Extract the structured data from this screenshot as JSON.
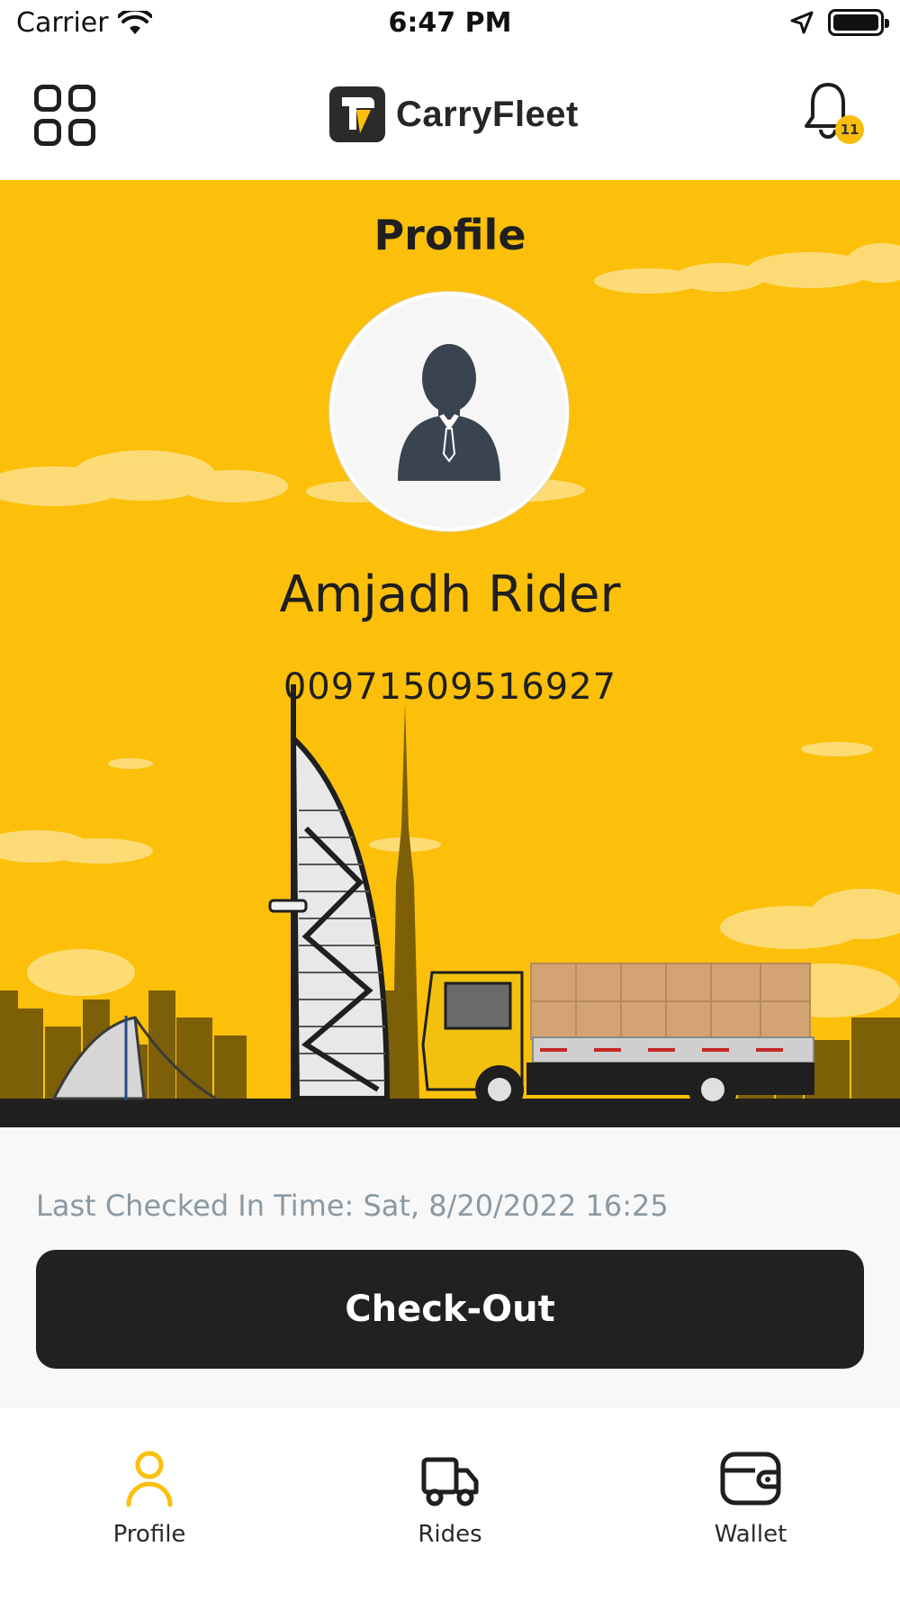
{
  "status_bar": {
    "carrier": "Carrier",
    "time": "6:47 PM"
  },
  "header": {
    "app_name": "CarryFleet",
    "notification_count": "11"
  },
  "profile": {
    "title": "Profile",
    "name": "Amjadh Rider",
    "phone": "00971509516927"
  },
  "check": {
    "last_checked_label": "Last Checked In Time: Sat, 8/20/2022 16:25",
    "button_label": "Check-Out"
  },
  "tabs": [
    {
      "label": "Profile",
      "icon": "person-icon",
      "active": true
    },
    {
      "label": "Rides",
      "icon": "truck-icon",
      "active": false
    },
    {
      "label": "Wallet",
      "icon": "wallet-icon",
      "active": false
    }
  ],
  "colors": {
    "brand_yellow": "#fcc00a",
    "dark": "#212121",
    "muted_text": "#8a98a2"
  }
}
